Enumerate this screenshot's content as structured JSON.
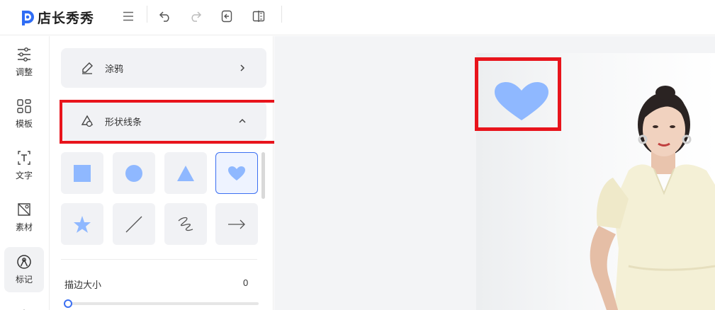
{
  "app": {
    "name": "店长秀秀",
    "brand_color": "#2f6df5"
  },
  "toolbar": {
    "icons": [
      "menu-icon",
      "undo-icon",
      "redo-icon",
      "import-icon",
      "compare-icon"
    ]
  },
  "rail": {
    "items": [
      {
        "label": "调整",
        "icon": "sliders-icon"
      },
      {
        "label": "模板",
        "icon": "template-icon"
      },
      {
        "label": "文字",
        "icon": "text-icon"
      },
      {
        "label": "素材",
        "icon": "material-icon"
      },
      {
        "label": "标记",
        "icon": "mark-icon",
        "active": true
      }
    ]
  },
  "panel": {
    "doodle_label": "涂鸦",
    "shapes_label": "形状线条",
    "shapes": [
      "square",
      "circle",
      "triangle",
      "heart",
      "star",
      "line",
      "scribble",
      "arrow"
    ],
    "selected_shape": "heart",
    "shape_color": "#8fb8ff",
    "stroke_label": "描边大小",
    "stroke_value": "0"
  },
  "colors": {
    "highlight": "#e8141c",
    "accent": "#3b6ff2"
  }
}
